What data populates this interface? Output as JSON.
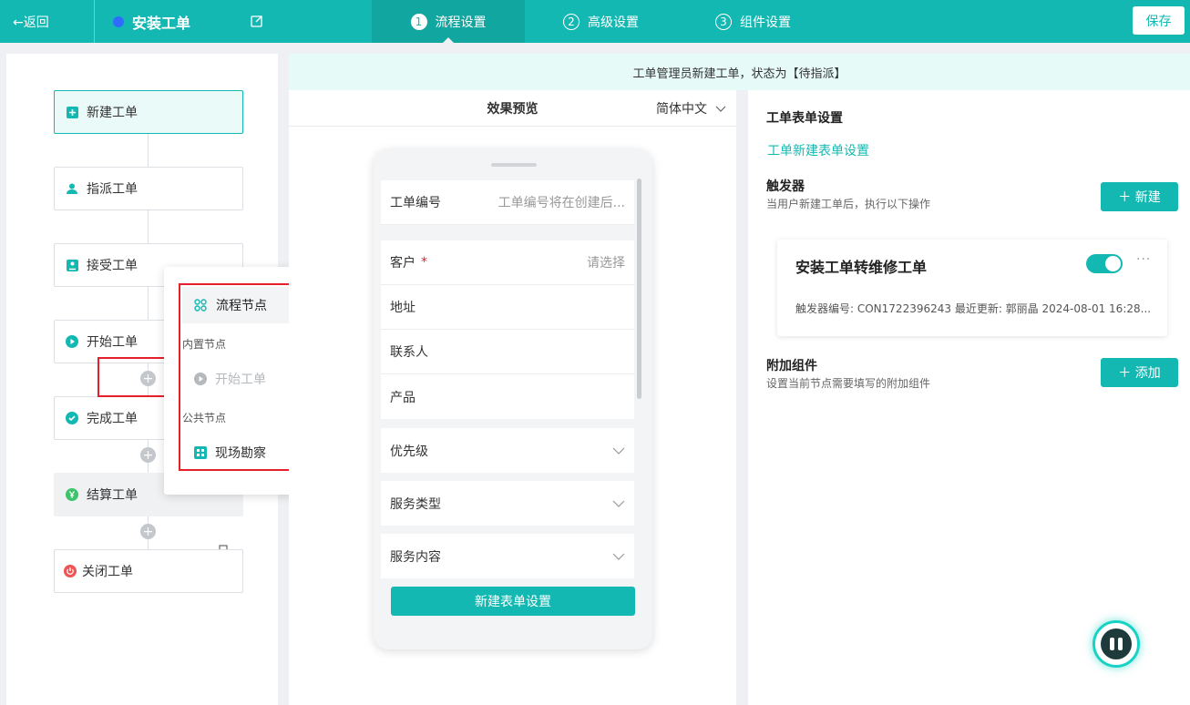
{
  "topbar": {
    "back_label": "←返回",
    "title": "安装工单",
    "steps": [
      {
        "num": "1",
        "label": "流程设置"
      },
      {
        "num": "2",
        "label": "高级设置"
      },
      {
        "num": "3",
        "label": "组件设置"
      }
    ],
    "save_label": "保存"
  },
  "flow": {
    "nodes": [
      "新建工单",
      "指派工单",
      "接受工单",
      "开始工单",
      "完成工单",
      "结算工单",
      "关闭工单"
    ]
  },
  "popup": {
    "header": "流程节点",
    "builtin_label": "内置节点",
    "builtin_item": "开始工单",
    "public_label": "公共节点",
    "public_item": "现场勘察"
  },
  "banner": "工单管理员新建工单，状态为【待指派】",
  "preview": {
    "title": "效果预览",
    "language": "简体中文",
    "fields": {
      "ticket_no": {
        "label": "工单编号",
        "value": "工单编号将在创建后..."
      },
      "customer": {
        "label": "客户",
        "required": "*",
        "value": "请选择"
      },
      "address": "地址",
      "contact": "联系人",
      "product": "产品",
      "priority": "优先级",
      "service_type": "服务类型",
      "service_content": "服务内容"
    },
    "button_label": "新建表单设置"
  },
  "settings": {
    "form_heading": "工单表单设置",
    "form_link": "工单新建表单设置",
    "trigger_heading": "触发器",
    "trigger_desc": "当用户新建工单后，执行以下操作",
    "new_label": "＋ 新建",
    "trigger_card": {
      "name": "安装工单转维修工单",
      "meta": "触发器编号: CON1722396243  最近更新: 郭丽晶  2024-08-01 16:28..."
    },
    "addon_heading": "附加组件",
    "addon_desc": "设置当前节点需要填写的附加组件",
    "add_label": "＋ 添加"
  },
  "colors": {
    "brand": "#14b8b2",
    "highlight": "#e5202a"
  }
}
